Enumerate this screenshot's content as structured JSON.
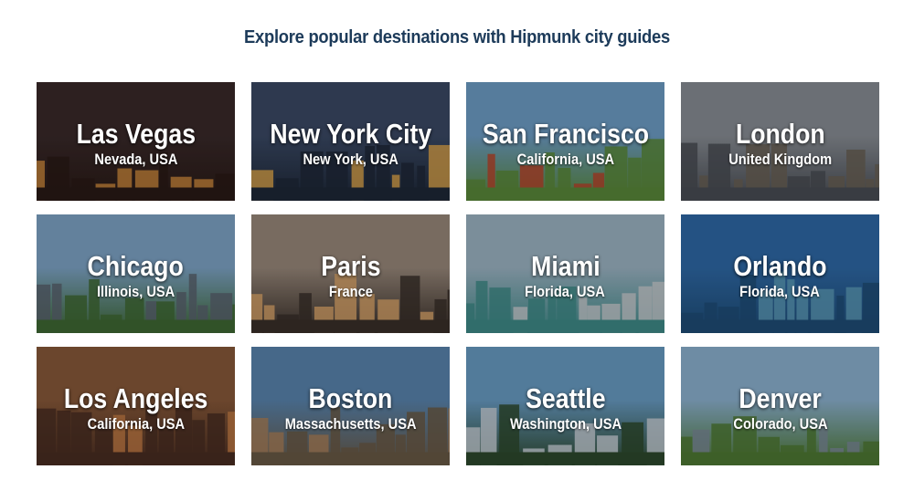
{
  "page": {
    "heading": "Explore popular destinations with Hipmunk city guides"
  },
  "cards": [
    {
      "city": "Las Vegas",
      "region": "Nevada, USA",
      "sky": "#3a2a2a",
      "ground": "#2a1a16",
      "accent": "#c9873c"
    },
    {
      "city": "New York City",
      "region": "New York, USA",
      "sky": "#3b4a66",
      "ground": "#1e2838",
      "accent": "#d9a24a"
    },
    {
      "city": "San Francisco",
      "region": "California, USA",
      "sky": "#6f9fc8",
      "ground": "#5a8a3a",
      "accent": "#b8452c"
    },
    {
      "city": "London",
      "region": "United Kingdom",
      "sky": "#8a8f96",
      "ground": "#4a4e55",
      "accent": "#6a6256"
    },
    {
      "city": "Chicago",
      "region": "Illinois, USA",
      "sky": "#7fa6c8",
      "ground": "#3f6a34",
      "accent": "#5a6470"
    },
    {
      "city": "Paris",
      "region": "France",
      "sky": "#9a8a7c",
      "ground": "#3a302a",
      "accent": "#d9a46a"
    },
    {
      "city": "Miami",
      "region": "Florida, USA",
      "sky": "#9eb6c6",
      "ground": "#3f8c8a",
      "accent": "#c8ccd0"
    },
    {
      "city": "Orlando",
      "region": "Florida, USA",
      "sky": "#2f6aa8",
      "ground": "#1f4e78",
      "accent": "#5a9ab8"
    },
    {
      "city": "Los Angeles",
      "region": "California, USA",
      "sky": "#8a5a3a",
      "ground": "#4a2e22",
      "accent": "#c27a44"
    },
    {
      "city": "Boston",
      "region": "Massachusetts, USA",
      "sky": "#5a86b0",
      "ground": "#6a5a46",
      "accent": "#a8805a"
    },
    {
      "city": "Seattle",
      "region": "Washington, USA",
      "sky": "#6a9ec6",
      "ground": "#2e4a2e",
      "accent": "#c8d0d8"
    },
    {
      "city": "Denver",
      "region": "Colorado, USA",
      "sky": "#8eb4d2",
      "ground": "#4f7a34",
      "accent": "#7a8a96"
    }
  ]
}
